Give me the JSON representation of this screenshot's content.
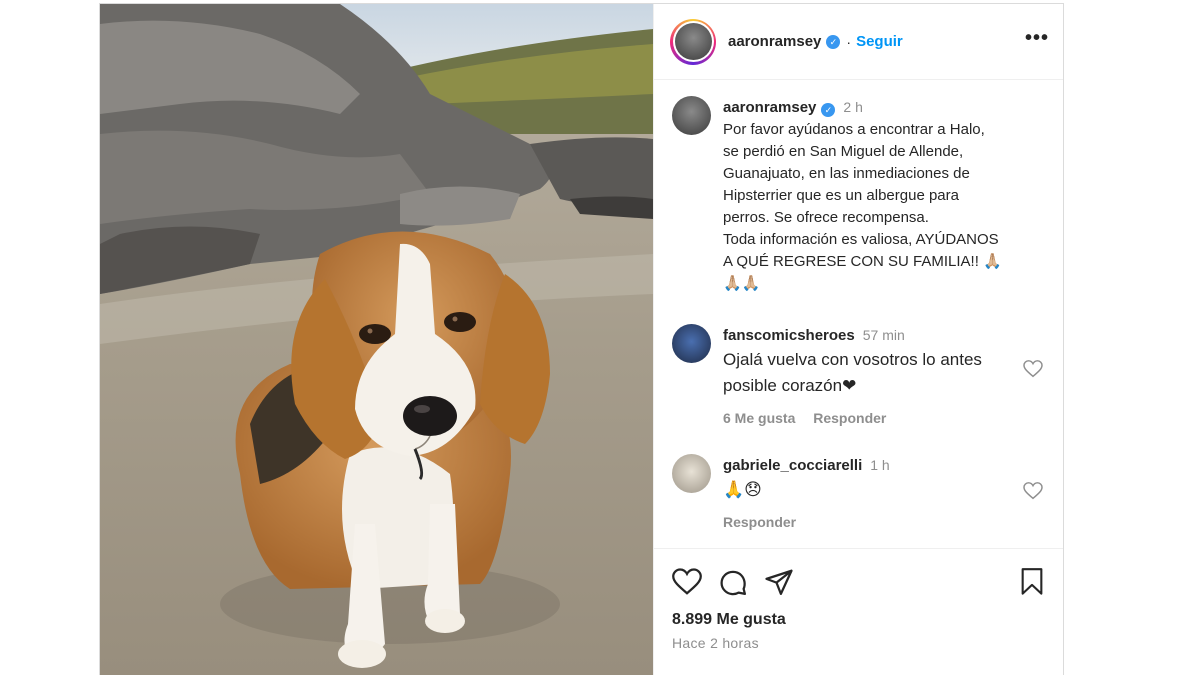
{
  "post": {
    "author": "aaronramsey",
    "verified_badge": "✓",
    "dot": "·",
    "follow_label": "Seguir",
    "more_label": "•••",
    "photo_subject": "beagle-on-beach"
  },
  "caption": {
    "username": "aaronramsey",
    "time": "2 h",
    "text": "Por favor ayúdanos a encontrar a Halo,\nse perdió en San Miguel de Allende,\nGuanajuato, en las inmediaciones de\nHipsterrier que es un albergue para\nperros.  Se ofrece recompensa.\nToda información es valiosa, AYÚDANOS\nA QUÉ REGRESE CON SU FAMILIA!! 🙏🏼\n🙏🏼🙏🏼"
  },
  "comments": [
    {
      "username": "fanscomicsheroes",
      "time": "57 min",
      "text": "Ojalá vuelva con vosotros lo antes posible corazón❤",
      "likes": "6 Me gusta",
      "reply": "Responder"
    },
    {
      "username": "gabriele_cocciarelli",
      "time": "1 h",
      "text": "🙏😞",
      "reply": "Responder"
    }
  ],
  "footer": {
    "likes": "8.899 Me gusta",
    "posted": "Hace 2 horas"
  },
  "icons": [
    "heart-icon",
    "comment-icon",
    "share-icon",
    "bookmark-icon"
  ],
  "colors": {
    "accent": "#0095f6",
    "verified": "#3897f0",
    "muted": "#8e8e8e"
  }
}
